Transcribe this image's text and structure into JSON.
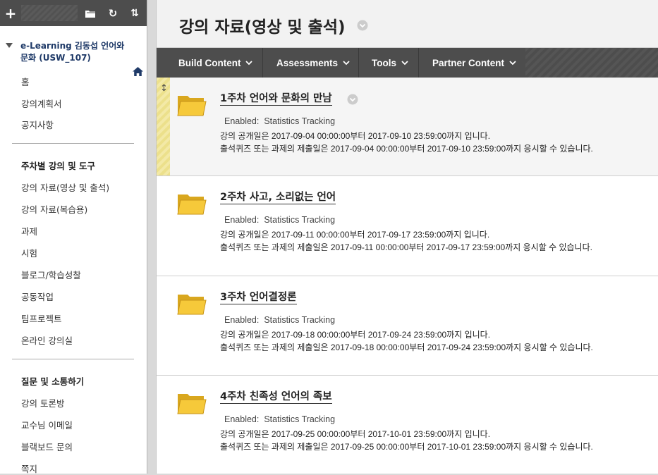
{
  "sidebar": {
    "toolbar": {
      "add_icon": "plus-icon",
      "folder_icon": "folder-icon",
      "refresh_icon": "refresh-icon",
      "sort_icon": "sort-icon"
    },
    "course_title": "e-Learning 김동섭 언어와 문화 (USW_107)",
    "menu_items": [
      "홈",
      "강의계획서",
      "공지사항"
    ],
    "section1_heading": "주차별 강의 및 도구",
    "section1_items": [
      "강의 자료(영상 및 출석)",
      "강의 자료(복습용)",
      "과제",
      "시험",
      "블로그/학습성찰",
      "공동작업",
      "팀프로젝트",
      "온라인 강의실"
    ],
    "section2_heading": "질문 및 소통하기",
    "section2_items": [
      "강의 토론방",
      "교수님 이메일",
      "블랙보드 문의",
      "쪽지"
    ]
  },
  "header": {
    "title": "강의 자료(영상 및 출석)"
  },
  "action_bar": {
    "buttons": [
      "Build Content",
      "Assessments",
      "Tools",
      "Partner Content"
    ]
  },
  "items": [
    {
      "title": "1주차 언어와 문화의 만남",
      "enabled_label": "Enabled:",
      "enabled_value": "Statistics Tracking",
      "line1": "강의 공개일은 2017-09-04 00:00:00부터 2017-09-10 23:59:00까지 입니다.",
      "line2": "출석퀴즈 또는 과제의 제출일은 2017-09-04 00:00:00부터 2017-09-10 23:59:00까지 응시할 수 있습니다."
    },
    {
      "title": "2주차 사고, 소리없는 언어",
      "enabled_label": "Enabled:",
      "enabled_value": "Statistics Tracking",
      "line1": "강의 공개일은 2017-09-11 00:00:00부터 2017-09-17 23:59:00까지 입니다.",
      "line2": "출석퀴즈 또는 과제의 제출일은 2017-09-11 00:00:00부터 2017-09-17 23:59:00까지 응시할 수 있습니다."
    },
    {
      "title": "3주차 언어결정론",
      "enabled_label": "Enabled:",
      "enabled_value": "Statistics Tracking",
      "line1": "강의 공개일은 2017-09-18 00:00:00부터 2017-09-24 23:59:00까지 입니다.",
      "line2": "출석퀴즈 또는 과제의 제출일은 2017-09-18 00:00:00부터 2017-09-24 23:59:00까지 응시할 수 있습니다."
    },
    {
      "title": "4주차 친족성 언어의 족보",
      "enabled_label": "Enabled:",
      "enabled_value": "Statistics Tracking",
      "line1": "강의 공개일은 2017-09-25 00:00:00부터 2017-10-01 23:59:00까지 입니다.",
      "line2": "출석퀴즈 또는 과제의 제출일은 2017-09-25 00:00:00부터 2017-10-01 23:59:00까지 응시할 수 있습니다."
    }
  ]
}
